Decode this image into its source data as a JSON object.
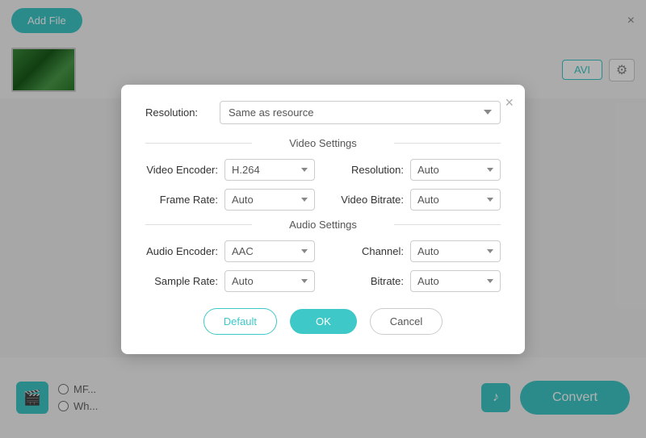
{
  "app": {
    "close_label": "×"
  },
  "toolbar": {
    "add_file_label": "Add File"
  },
  "format": {
    "badge_label": "AVI"
  },
  "convert": {
    "label": "Convert"
  },
  "bottom": {
    "radio1": "MF...",
    "radio2": "Wh..."
  },
  "modal": {
    "close_label": "×",
    "top_resolution_label": "Resolution:",
    "top_resolution_value": "Same as resource",
    "video_section_label": "Video Settings",
    "audio_section_label": "Audio Settings",
    "fields": {
      "video_encoder_label": "Video Encoder:",
      "video_encoder_value": "H.264",
      "resolution_label": "Resolution:",
      "resolution_value": "Auto",
      "frame_rate_label": "Frame Rate:",
      "frame_rate_value": "Auto",
      "video_bitrate_label": "Video Bitrate:",
      "video_bitrate_value": "Auto",
      "audio_encoder_label": "Audio Encoder:",
      "audio_encoder_value": "AAC",
      "channel_label": "Channel:",
      "channel_value": "Auto",
      "sample_rate_label": "Sample Rate:",
      "sample_rate_value": "Auto",
      "bitrate_label": "Bitrate:",
      "bitrate_value": "Auto"
    },
    "btn_default": "Default",
    "btn_ok": "OK",
    "btn_cancel": "Cancel"
  }
}
